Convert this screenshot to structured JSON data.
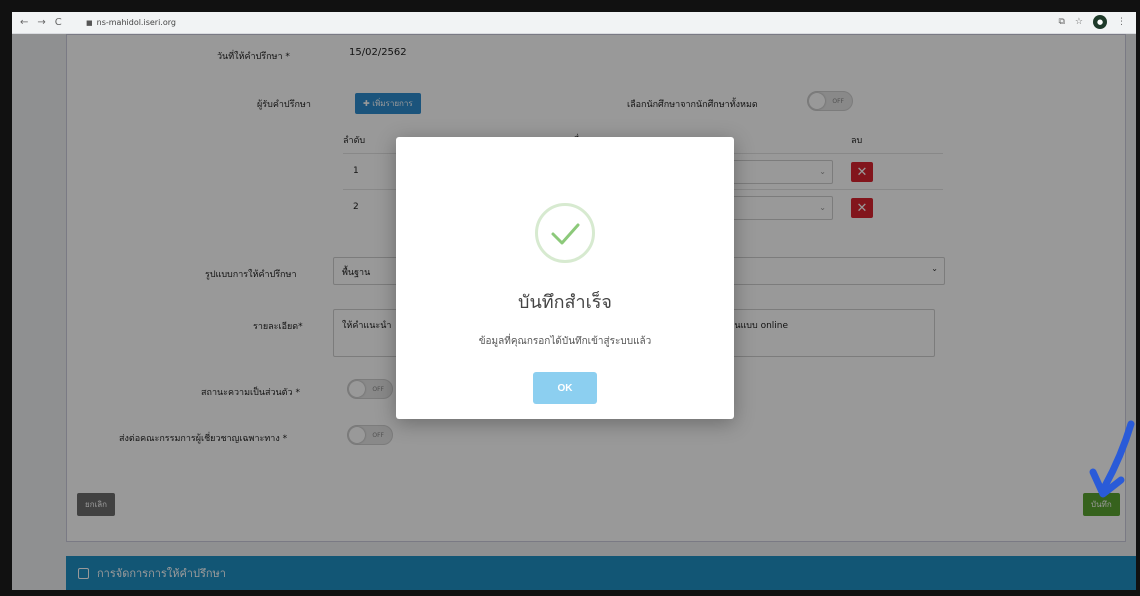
{
  "browser": {
    "url": "ns-mahidol.iseri.org",
    "back": "←",
    "forward": "→",
    "reload": "C"
  },
  "form": {
    "date_label": "วันที่ให้คำปรึกษา *",
    "date_value": "15/02/2562",
    "receiver_label": "ผู้รับคำปรึกษา",
    "add_button_label": "เพิ่มรายการ",
    "select_student_label": "เลือกนักศึกษาจากนักศึกษาทั้งหมด",
    "toggle_off": "OFF",
    "table": {
      "headers": [
        "ลำดับ",
        "ชื่อ-นามสกุล",
        "ลบ"
      ],
      "rows": [
        {
          "index": "1"
        },
        {
          "index": "2"
        }
      ],
      "delete_symbol": "✕"
    },
    "format_label": "รูปแบบการให้คำปรึกษา",
    "format_value": "พื้นฐาน",
    "detail_label": "รายละเอียด*",
    "detail_value_left": "ให้คำแนะนำ",
    "detail_value_right": "ผ่านแบบ online",
    "private_label": "สถานะความเป็นส่วนตัว *",
    "refer_label": "ส่งต่อคณะกรรมการผู้เชี่ยวชาญเฉพาะทาง *",
    "cancel_label": "ยกเลิก",
    "save_label": "บันทึก"
  },
  "section": {
    "title": "การจัดการการให้คำปรึกษา"
  },
  "modal": {
    "title": "บันทึกสำเร็จ",
    "message": "ข้อมูลที่คุณกรอกได้บันทึกเข้าสู่ระบบแล้ว",
    "ok_label": "OK",
    "colors": {
      "check": "#8cc97a",
      "ok": "#8ccff0"
    }
  }
}
